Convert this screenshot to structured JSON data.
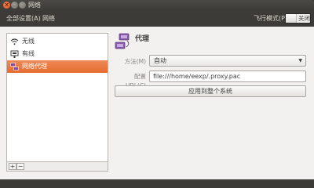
{
  "window": {
    "title": "网络",
    "close_glyph": "×"
  },
  "toolbar": {
    "all_settings": "全部设置(A)",
    "current": "网络",
    "airplane_mode_label": "飞行模式(P)",
    "airplane_mode_state": "关闭"
  },
  "sidebar": {
    "items": [
      {
        "label": "无线",
        "icon": "wifi-icon",
        "selected": false
      },
      {
        "label": "有线",
        "icon": "wired-icon",
        "selected": false
      },
      {
        "label": "网络代理",
        "icon": "proxy-icon",
        "selected": true
      }
    ],
    "add_label": "+",
    "remove_label": "−"
  },
  "panel": {
    "title": "代理",
    "method_label": "方法(M)",
    "method_value": "自动",
    "config_url_label": "配置 URL(C)",
    "config_url_value": "file:///home/eexp/.proxy.pac",
    "apply_button": "应用到整个系统"
  },
  "colors": {
    "accent": "#e36b30",
    "titlebar": "#3c3b37",
    "content_bg": "#f2f1f0"
  }
}
